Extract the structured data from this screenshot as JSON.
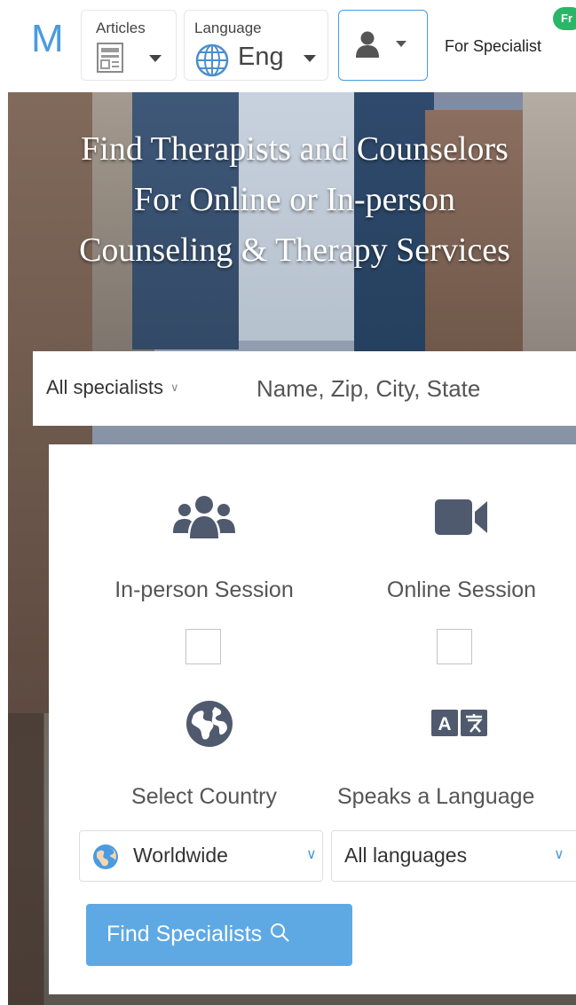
{
  "header": {
    "logo_letter": "M",
    "articles_label": "Articles",
    "language_label": "Language",
    "language_value": "Eng",
    "for_specialists": "For Specialist",
    "new_badge": "Fr"
  },
  "hero": {
    "title_line1": "Find Therapists and Counselors",
    "title_line2": "For Online or In-person",
    "title_line3": "Counseling & Therapy Services"
  },
  "search": {
    "specialist_select": "All specialists",
    "placeholder": "Name, Zip, City, State"
  },
  "filters": {
    "in_person_label": "In-person Session",
    "online_label": "Online Session",
    "country_label": "Select Country",
    "language_label": "Speaks a Language",
    "country_value": "Worldwide",
    "language_value": "All languages",
    "find_button": "Find Specialists"
  },
  "colors": {
    "accent": "#4a9be0",
    "button": "#5ea9e3",
    "icon": "#505a6e",
    "badge": "#29b767"
  },
  "icons": [
    "article-icon",
    "globe-icon",
    "user-icon",
    "users-icon",
    "video-camera-icon",
    "earth-icon",
    "translate-icon",
    "search-icon"
  ]
}
